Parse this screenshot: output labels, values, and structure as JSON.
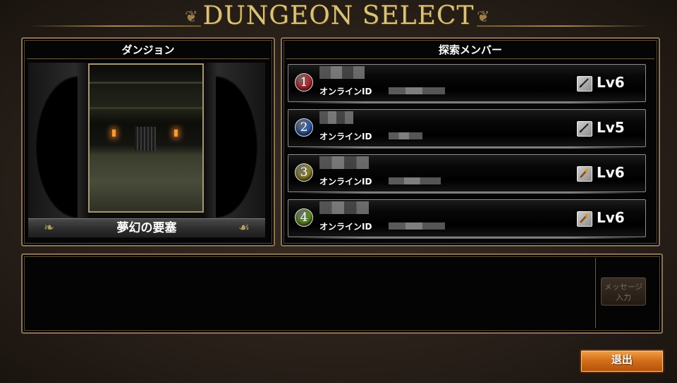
{
  "header": {
    "title": "DUNGEON SELECT"
  },
  "dungeon_panel": {
    "heading": "ダンジョン",
    "dungeon_name": "夢幻の要塞"
  },
  "members_panel": {
    "heading": "探索メンバー",
    "members": [
      {
        "number": "1",
        "online_label": "オンラインID",
        "level": "Lv6",
        "weapon_icon": "sword-icon",
        "badge_color": "#b2282a"
      },
      {
        "number": "2",
        "online_label": "オンラインID",
        "level": "Lv5",
        "weapon_icon": "sword-icon",
        "badge_color": "#2a5aa8"
      },
      {
        "number": "3",
        "online_label": "オンラインID",
        "level": "Lv6",
        "weapon_icon": "staff-icon",
        "badge_color": "#8c8228"
      },
      {
        "number": "4",
        "online_label": "オンラインID",
        "level": "Lv6",
        "weapon_icon": "staff-icon",
        "badge_color": "#5a8a1e"
      }
    ]
  },
  "message_area": {
    "button_label_line1": "メッセージ",
    "button_label_line2": "入力"
  },
  "footer": {
    "exit_label": "退出"
  }
}
